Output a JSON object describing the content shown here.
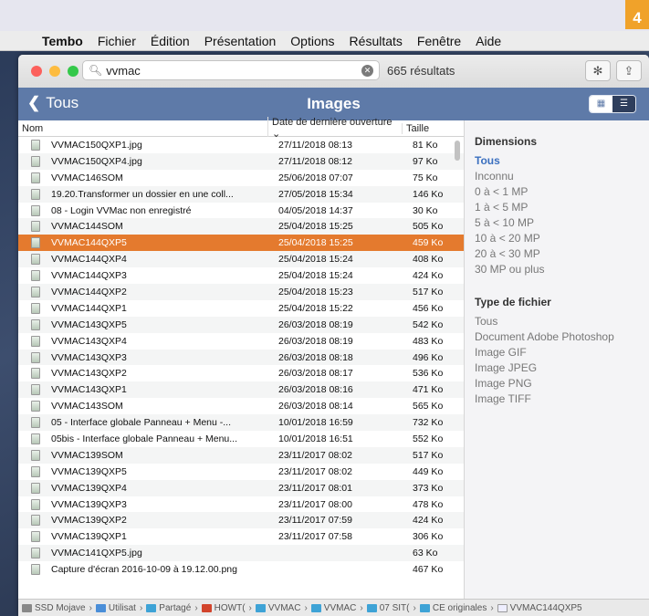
{
  "badge": "4",
  "menubar": {
    "apple": "",
    "items": [
      "Tembo",
      "Fichier",
      "Édition",
      "Présentation",
      "Options",
      "Résultats",
      "Fenêtre",
      "Aide"
    ]
  },
  "search": {
    "value": "vvmac",
    "results": "665 résultats"
  },
  "header": {
    "back_label": "Tous",
    "title": "Images"
  },
  "columns": {
    "name": "Nom",
    "date": "Date de dernière ouverture ⌄",
    "size": "Taille"
  },
  "rows": [
    {
      "name": "VVMAC150QXP1.jpg",
      "date": "27/11/2018 08:13",
      "size": "81 Ko"
    },
    {
      "name": "VVMAC150QXP4.jpg",
      "date": "27/11/2018 08:12",
      "size": "97 Ko"
    },
    {
      "name": "VVMAC146SOM",
      "date": "25/06/2018 07:07",
      "size": "75 Ko"
    },
    {
      "name": "19.20.Transformer un dossier en une coll...",
      "date": "27/05/2018 15:34",
      "size": "146 Ko"
    },
    {
      "name": "08 - Login VVMac non enregistré",
      "date": "04/05/2018 14:37",
      "size": "30 Ko"
    },
    {
      "name": "VVMAC144SOM",
      "date": "25/04/2018 15:25",
      "size": "505 Ko"
    },
    {
      "name": "VVMAC144QXP5",
      "date": "25/04/2018 15:25",
      "size": "459 Ko",
      "selected": true
    },
    {
      "name": "VVMAC144QXP4",
      "date": "25/04/2018 15:24",
      "size": "408 Ko"
    },
    {
      "name": "VVMAC144QXP3",
      "date": "25/04/2018 15:24",
      "size": "424 Ko"
    },
    {
      "name": "VVMAC144QXP2",
      "date": "25/04/2018 15:23",
      "size": "517 Ko"
    },
    {
      "name": "VVMAC144QXP1",
      "date": "25/04/2018 15:22",
      "size": "456 Ko"
    },
    {
      "name": "VVMAC143QXP5",
      "date": "26/03/2018 08:19",
      "size": "542 Ko"
    },
    {
      "name": "VVMAC143QXP4",
      "date": "26/03/2018 08:19",
      "size": "483 Ko"
    },
    {
      "name": "VVMAC143QXP3",
      "date": "26/03/2018 08:18",
      "size": "496 Ko"
    },
    {
      "name": "VVMAC143QXP2",
      "date": "26/03/2018 08:17",
      "size": "536 Ko"
    },
    {
      "name": "VVMAC143QXP1",
      "date": "26/03/2018 08:16",
      "size": "471 Ko"
    },
    {
      "name": "VVMAC143SOM",
      "date": "26/03/2018 08:14",
      "size": "565 Ko"
    },
    {
      "name": "05 - Interface globale Panneau + Menu -...",
      "date": "10/01/2018 16:59",
      "size": "732 Ko"
    },
    {
      "name": "05bis - Interface globale Panneau + Menu...",
      "date": "10/01/2018 16:51",
      "size": "552 Ko"
    },
    {
      "name": "VVMAC139SOM",
      "date": "23/11/2017 08:02",
      "size": "517 Ko"
    },
    {
      "name": "VVMAC139QXP5",
      "date": "23/11/2017 08:02",
      "size": "449 Ko"
    },
    {
      "name": "VVMAC139QXP4",
      "date": "23/11/2017 08:01",
      "size": "373 Ko"
    },
    {
      "name": "VVMAC139QXP3",
      "date": "23/11/2017 08:00",
      "size": "478 Ko"
    },
    {
      "name": "VVMAC139QXP2",
      "date": "23/11/2017 07:59",
      "size": "424 Ko"
    },
    {
      "name": "VVMAC139QXP1",
      "date": "23/11/2017 07:58",
      "size": "306 Ko"
    },
    {
      "name": "VVMAC141QXP5.jpg",
      "date": "",
      "size": "63 Ko"
    },
    {
      "name": "Capture d'écran 2016-10-09 à 19.12.00.png",
      "date": "",
      "size": "467 Ko"
    }
  ],
  "sidebar": {
    "dimensions_title": "Dimensions",
    "dimensions": [
      "Tous",
      "Inconnu",
      "0 à < 1 MP",
      "1 à < 5 MP",
      "5 à < 10 MP",
      "10 à < 20 MP",
      "20 à < 30 MP",
      "30 MP ou plus"
    ],
    "filetype_title": "Type de fichier",
    "filetypes": [
      "Tous",
      "Document Adobe Photoshop",
      "Image GIF",
      "Image JPEG",
      "Image PNG",
      "Image TIFF"
    ]
  },
  "pathbar": [
    {
      "label": "SSD Mojave",
      "icon": "disk-icon"
    },
    {
      "label": "Utilisat",
      "icon": "user-folder-icon"
    },
    {
      "label": "Partagé",
      "icon": "folder-icon"
    },
    {
      "label": "HOWT(",
      "icon": "howto-folder-icon"
    },
    {
      "label": "VVMAC",
      "icon": "folder-icon"
    },
    {
      "label": "VVMAC",
      "icon": "folder-icon"
    },
    {
      "label": "07 SIT(",
      "icon": "folder-icon"
    },
    {
      "label": "CE originales",
      "icon": "folder-icon"
    },
    {
      "label": "VVMAC144QXP5",
      "icon": "file-icon"
    }
  ],
  "colors": {
    "header_bg": "#5e7aa8",
    "selection": "#e47a2e",
    "badge": "#f0a22a",
    "active_filter": "#3a6fbf"
  }
}
